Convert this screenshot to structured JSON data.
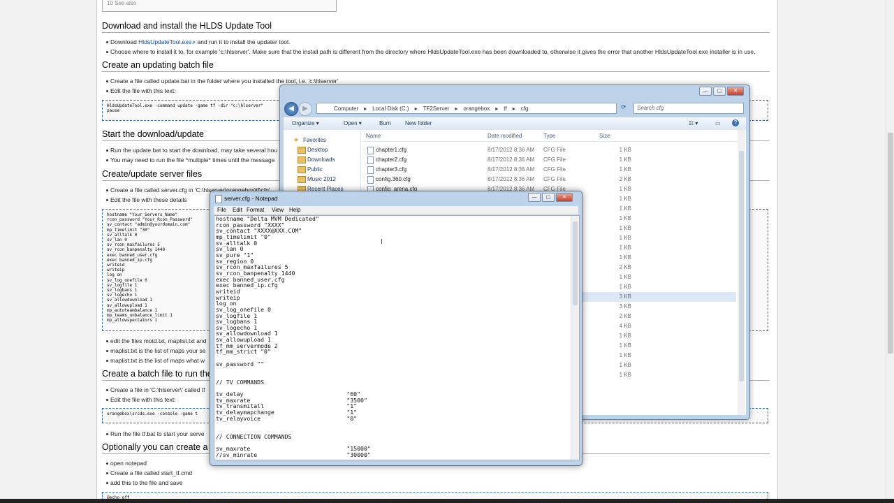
{
  "wiki": {
    "toc_item": "10 See also",
    "sections": [
      {
        "heading": "Download and install the HLDS Update Tool"
      },
      {
        "heading": "Create an updating batch file"
      },
      {
        "heading": "Start the download/update"
      },
      {
        "heading": "Create/update server files"
      },
      {
        "heading": "Create a batch file to run the"
      },
      {
        "heading": "Optionally you can create a"
      }
    ],
    "s1_b1_pre": "Download ",
    "s1_b1_link": "HldsUpdateTool.exe",
    "s1_b1_post": " and run it to install the updater tool.",
    "s1_b2": "Choose where to install it to, for example 'c:\\hlserver'. Make sure that the install path is different from the directory where HldsUpdateTool.exe has been downloaded to, otherwise it gives the error that another HldsUpdateTool.exe installer is in use.",
    "s2_b1": "Create a file called update.bat in the folder where you installed the tool, i.e. 'c:\\hlserver'",
    "s2_b2": "Edit the file with this text:",
    "s2_code": "HldsUpdateTool.exe -command update -game tf -dir \"c:\\hlserver\"\npause",
    "s3_b1": "Run the update.bat to start the download, may take several hou",
    "s3_b2": "You may need to run the file *multiple* times until the message",
    "s4_b1": "Create a file called server.cfg in 'C:\\hlserver\\orangebox\\tf\\cfg'",
    "s4_b2": "Edit the file with these details",
    "s4_code": "hostname \"Your_Servers_Name\"\nrcon_password \"Your_Rcon_Password\"\nsv_contact \"admin@yourdomain.com\"\nmp_timelimit \"30\"\nsv_alltalk 0\nsv_lan 0\nsv_rcon_maxfailures 5\nsv_rcon_banpenalty 1440\nexec banned_user.cfg\nexec banned_ip.cfg\nwriteid\nwriteip\nlog on\nsv_log_onefile 0\nsv_logfile 1\nsv_logbans 1\nsv_logecho 1\nsv_allowdownload 1\nsv_allowupload 1\nmp_autoteambalance 1\nmp_teams_unbalance_limit 1\nmp_allowspectators 1",
    "s4_b3": "edit the files motd.txt, maplist.txt and",
    "s4_b4": "maplist.txt is the list of maps your se",
    "s4_b5": "maplist.txt is the list of maps what w",
    "s5_b1": "Create a file in 'C:\\hlserver\\' called tf",
    "s5_b2": "Edit the file with this text:",
    "s5_code": "orangebox\\srcds.exe -console -game t",
    "s5_b3": "Run the file tf.bat to start your serve",
    "s6_b1": "open notepad",
    "s6_b2": "Create a file called start_tf.cmd",
    "s6_b3": "add this to the file and save",
    "s6_code": "@echo off"
  },
  "explorer": {
    "breadcrumb": [
      "Computer",
      "Local Disk (C:)",
      "TF2Server",
      "orangebox",
      "tf",
      "cfg"
    ],
    "search_placeholder": "Search cfg",
    "toolbar": {
      "organize": "Organize ▾",
      "open": "Open ▾",
      "burn": "Burn",
      "new_folder": "New folder"
    },
    "nav": [
      "Favorites",
      "Desktop",
      "Downloads",
      "Public",
      "Music 2012",
      "Recent Places"
    ],
    "columns": {
      "name": "Name",
      "date": "Date modified",
      "type": "Type",
      "size": "Size"
    },
    "files": [
      {
        "name": "chapter1.cfg",
        "date": "8/17/2012 8:36 AM",
        "type": "CFG File",
        "size": "1 KB"
      },
      {
        "name": "chapter2.cfg",
        "date": "8/17/2012 8:36 AM",
        "type": "CFG File",
        "size": "1 KB"
      },
      {
        "name": "chapter3.cfg",
        "date": "8/17/2012 8:36 AM",
        "type": "CFG File",
        "size": "1 KB"
      },
      {
        "name": "config.360.cfg",
        "date": "8/17/2012 8:36 AM",
        "type": "CFG File",
        "size": "2 KB"
      },
      {
        "name": "config_arena.cfg",
        "date": "8/17/2012 8:36 AM",
        "type": "CFG File",
        "size": "1 KB"
      }
    ],
    "hidden_sizes": [
      "1 KB",
      "1 KB",
      "1 KB",
      "1 KB",
      "1 KB",
      "1 KB",
      "1 KB",
      "2 KB",
      "1 KB",
      "1 KB",
      "3 KB",
      "3 KB",
      "2 KB",
      "4 KB",
      "1 KB",
      "1 KB",
      "1 KB",
      "1 KB",
      "1 KB"
    ]
  },
  "notepad": {
    "title": "server.cfg - Notepad",
    "menu": [
      "File",
      "Edit",
      "Format",
      "View",
      "Help"
    ],
    "text": "hostname \"Delta MVM Dedicated\"\nrcon_password \"XXXX\"\nsv_contact \"XXXX@XXX.COM\"\nmp_timelimit \"0\"\nsv_alltalk 0\nsv_lan 0\nsv_pure \"1\"\nsv_region 0\nsv_rcon_maxfailures 5\nsv_rcon_banpenalty 1440\nexec banned_user.cfg\nexec banned_ip.cfg\nwriteid\nwriteip\nlog on\nsv_log_onefile 0\nsv_logfile 1\nsv_logbans 1\nsv_logecho 1\nsv_allowdownload 1\nsv_allowupload 1\ntf_mm_servermode 2\ntf_mm_strict \"0\"\n\nsv_password \"\"\n\n\n// TV COMMANDS\n\ntv_delay                              \"60\"\ntv_maxrate                            \"3500\"\ntv_transmitall                        \"1\"\ntv_delaymapchange                     \"1\"\ntv_relayvoice                         \"0\"\n\n\n// CONNECTION COMMANDS\n\nsv_maxrate                            \"15000\"\n//sv_minrate                          \"30000\""
  }
}
